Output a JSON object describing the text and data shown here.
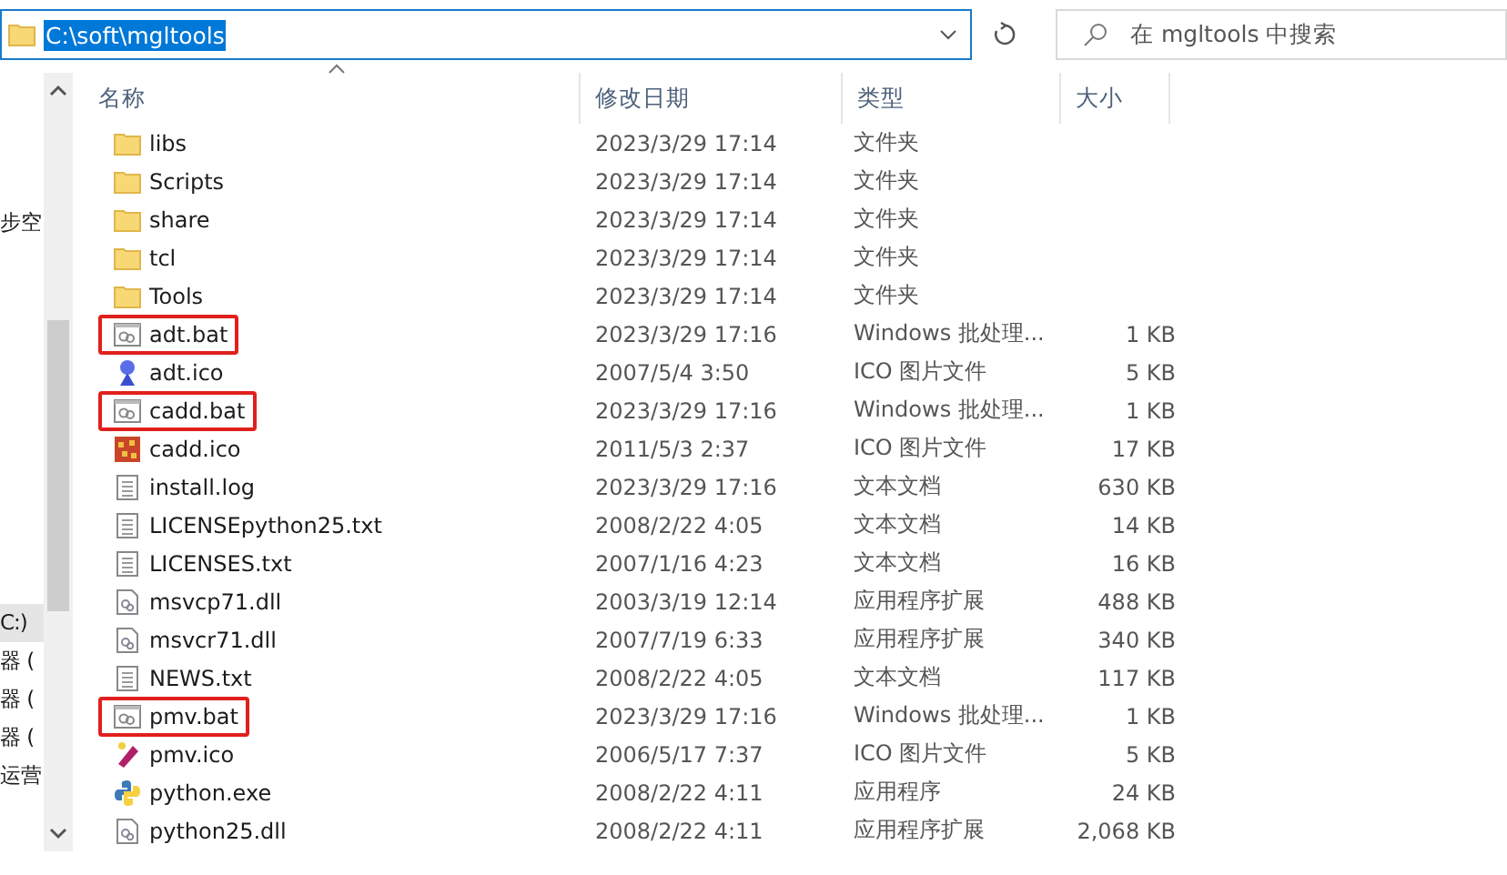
{
  "address_bar": {
    "path": "C:\\soft\\mgltools"
  },
  "search": {
    "placeholder": "在 mgltools 中搜索"
  },
  "nav_pane": {
    "items": [
      {
        "label": "步空",
        "selected": false
      },
      {
        "label": "C:)",
        "selected": true
      },
      {
        "label": "器 (",
        "selected": false
      },
      {
        "label": "器 (",
        "selected": false
      },
      {
        "label": "器 (",
        "selected": false
      },
      {
        "label": "运营",
        "selected": false
      }
    ]
  },
  "columns": [
    "名称",
    "修改日期",
    "类型",
    "大小"
  ],
  "rows": [
    {
      "kind": "folder",
      "name": "libs",
      "date": "2023/3/29 17:14",
      "type": "文件夹",
      "size": "",
      "highlighted": false
    },
    {
      "kind": "folder",
      "name": "Scripts",
      "date": "2023/3/29 17:14",
      "type": "文件夹",
      "size": "",
      "highlighted": false
    },
    {
      "kind": "folder",
      "name": "share",
      "date": "2023/3/29 17:14",
      "type": "文件夹",
      "size": "",
      "highlighted": false
    },
    {
      "kind": "folder",
      "name": "tcl",
      "date": "2023/3/29 17:14",
      "type": "文件夹",
      "size": "",
      "highlighted": false
    },
    {
      "kind": "folder",
      "name": "Tools",
      "date": "2023/3/29 17:14",
      "type": "文件夹",
      "size": "",
      "highlighted": false
    },
    {
      "kind": "batch",
      "name": "adt.bat",
      "date": "2023/3/29 17:16",
      "type": "Windows 批处理...",
      "size": "1 KB",
      "highlighted": true
    },
    {
      "kind": "ico_blue",
      "name": "adt.ico",
      "date": "2007/5/4 3:50",
      "type": "ICO 图片文件",
      "size": "5 KB",
      "highlighted": false
    },
    {
      "kind": "batch",
      "name": "cadd.bat",
      "date": "2023/3/29 17:16",
      "type": "Windows 批处理...",
      "size": "1 KB",
      "highlighted": true
    },
    {
      "kind": "ico_red",
      "name": "cadd.ico",
      "date": "2011/5/3 2:37",
      "type": "ICO 图片文件",
      "size": "17 KB",
      "highlighted": false
    },
    {
      "kind": "text",
      "name": "install.log",
      "date": "2023/3/29 17:16",
      "type": "文本文档",
      "size": "630 KB",
      "highlighted": false
    },
    {
      "kind": "text",
      "name": "LICENSEpython25.txt",
      "date": "2008/2/22 4:05",
      "type": "文本文档",
      "size": "14 KB",
      "highlighted": false
    },
    {
      "kind": "text",
      "name": "LICENSES.txt",
      "date": "2007/1/16 4:23",
      "type": "文本文档",
      "size": "16 KB",
      "highlighted": false
    },
    {
      "kind": "dll",
      "name": "msvcp71.dll",
      "date": "2003/3/19 12:14",
      "type": "应用程序扩展",
      "size": "488 KB",
      "highlighted": false
    },
    {
      "kind": "dll",
      "name": "msvcr71.dll",
      "date": "2007/7/19 6:33",
      "type": "应用程序扩展",
      "size": "340 KB",
      "highlighted": false
    },
    {
      "kind": "text",
      "name": "NEWS.txt",
      "date": "2008/2/22 4:05",
      "type": "文本文档",
      "size": "117 KB",
      "highlighted": false
    },
    {
      "kind": "batch",
      "name": "pmv.bat",
      "date": "2023/3/29 17:16",
      "type": "Windows 批处理...",
      "size": "1 KB",
      "highlighted": true
    },
    {
      "kind": "ico_pink",
      "name": "pmv.ico",
      "date": "2006/5/17 7:37",
      "type": "ICO 图片文件",
      "size": "5 KB",
      "highlighted": false
    },
    {
      "kind": "python",
      "name": "python.exe",
      "date": "2008/2/22 4:11",
      "type": "应用程序",
      "size": "24 KB",
      "highlighted": false
    },
    {
      "kind": "dll",
      "name": "python25.dll",
      "date": "2008/2/22 4:11",
      "type": "应用程序扩展",
      "size": "2,068 KB",
      "highlighted": false
    }
  ]
}
